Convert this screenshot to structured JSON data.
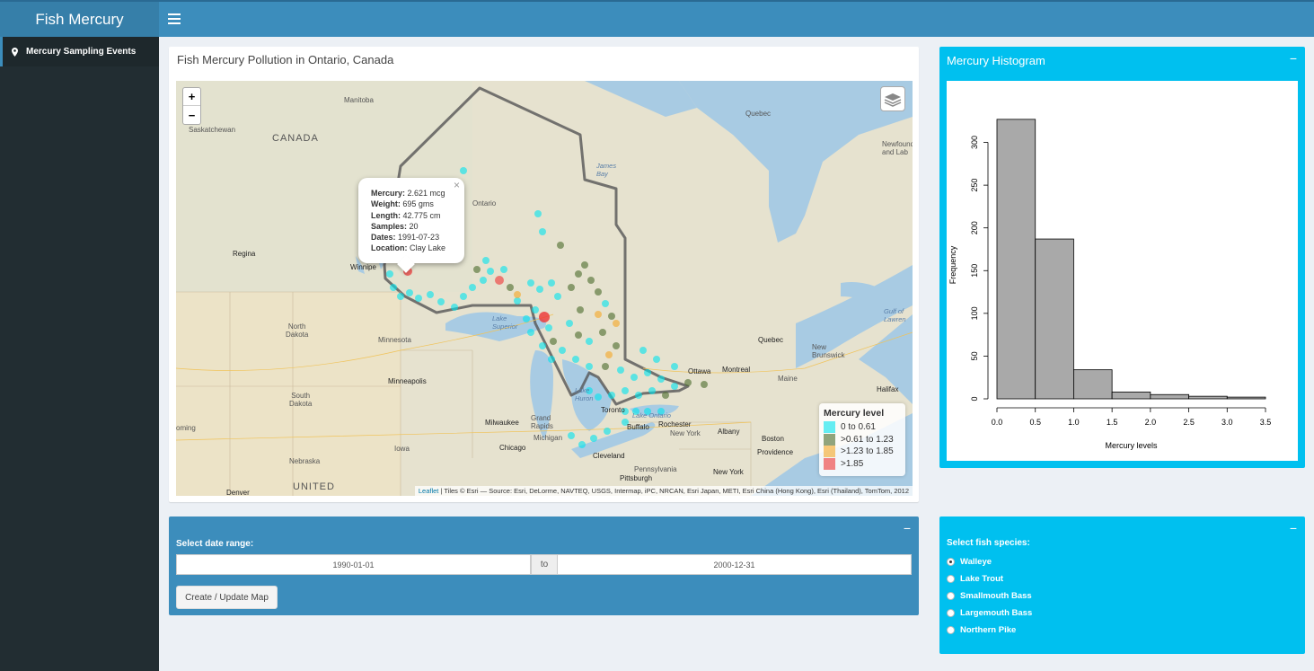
{
  "app": {
    "title": "Fish Mercury"
  },
  "sidebar": {
    "items": [
      {
        "label": "Mercury Sampling Events",
        "icon": "map-marker-icon"
      }
    ]
  },
  "map_box": {
    "title": "Fish Mercury Pollution in Ontario, Canada",
    "zoom_in": "+",
    "zoom_out": "−",
    "popup": {
      "close": "×",
      "rows": [
        {
          "key": "Mercury:",
          "value": "2.621 mcg"
        },
        {
          "key": "Weight:",
          "value": "695 gms"
        },
        {
          "key": "Length:",
          "value": "42.775 cm"
        },
        {
          "key": "Samples:",
          "value": "20"
        },
        {
          "key": "Dates:",
          "value": "1991-07-23"
        },
        {
          "key": "Location:",
          "value": "Clay Lake"
        }
      ]
    },
    "legend": {
      "title": "Mercury level",
      "items": [
        {
          "label": "0 to 0.61",
          "color": "#00e5ee"
        },
        {
          "label": ">0.61 to 1.23",
          "color": "#4a6b2a"
        },
        {
          "label": ">1.23 to 1.85",
          "color": "#f5a623"
        },
        {
          "label": ">1.85",
          "color": "#ee3333"
        }
      ]
    },
    "attribution": {
      "link": "Leaflet",
      "text": " | Tiles © Esri — Source: Esri, DeLorme, NAVTEQ, USGS, Intermap, iPC, NRCAN, Esri Japan, METI, Esri China (Hong Kong), Esri (Thailand), TomTom, 2012"
    },
    "labels": {
      "canada": "CANADA",
      "united": "UNITED",
      "manitoba": "Manitoba",
      "saskatchewan": "Saskatchewan",
      "quebec_prov": "Quebec",
      "ontario": "Ontario",
      "james_bay": "James\nBay",
      "newfoundland": "Newfound\nand Lab",
      "regina": "Regina",
      "winnipeg": "Winnipe",
      "north_dakota": "North\nDakota",
      "south_dakota": "South\nDakota",
      "minnesota": "Minnesota",
      "minneapolis": "Minneapolis",
      "nebraska": "Nebraska",
      "iowa": "Iowa",
      "wyoming": "oming",
      "denver": "Denver",
      "lake_superior": "Lake\nSuperior",
      "lake_michigan": "Lake\nMichigan",
      "lake_huron": "Lake\nHuron",
      "lake_ontario": "Lake Ontario",
      "milwaukee": "Milwaukee",
      "grand_rapids": "Grand\nRapids",
      "michigan": "Michigan",
      "chicago": "Chicago",
      "toronto": "Toronto",
      "buffalo": "Buffalo",
      "rochester": "Rochester",
      "cleveland": "Cleveland",
      "pittsburgh": "Pittsburgh",
      "pennsylvania": "Pennsylvania",
      "new_york": "New York",
      "new_york_city": "New York",
      "ottawa": "Ottawa",
      "montreal": "Montreal",
      "quebec_city": "Quebec",
      "albany": "Albany",
      "boston": "Boston",
      "providence": "Providence",
      "maine": "Maine",
      "new_brunswick": "New\nBrunswick",
      "halifax": "Halifax",
      "gulf": "Gulf of\nLawren"
    }
  },
  "histogram": {
    "title": "Mercury Histogram",
    "collapse": "−",
    "chart_data": {
      "type": "bar",
      "xlabel": "Mercury levels",
      "ylabel": "Frequency",
      "bins": [
        [
          0.0,
          0.5
        ],
        [
          0.5,
          1.0
        ],
        [
          1.0,
          1.5
        ],
        [
          1.5,
          2.0
        ],
        [
          2.0,
          2.5
        ],
        [
          2.5,
          3.0
        ],
        [
          3.0,
          3.5
        ]
      ],
      "values": [
        327,
        187,
        34,
        8,
        5,
        3,
        2
      ],
      "xlim": [
        0,
        3.5
      ],
      "ylim": [
        0,
        330
      ],
      "xticks": [
        "0.0",
        "0.5",
        "1.0",
        "1.5",
        "2.0",
        "2.5",
        "3.0",
        "3.5"
      ],
      "yticks": [
        "0",
        "50",
        "100",
        "150",
        "200",
        "250",
        "300"
      ],
      "bar_color": "#a9a9a9",
      "grid": false
    }
  },
  "date_box": {
    "label": "Select date range:",
    "start": "1990-01-01",
    "separator": "to",
    "end": "2000-12-31",
    "button": "Create / Update Map",
    "collapse": "−"
  },
  "species_box": {
    "label": "Select fish species:",
    "collapse": "−",
    "options": [
      {
        "label": "Walleye",
        "selected": true
      },
      {
        "label": "Lake Trout",
        "selected": false
      },
      {
        "label": "Smallmouth Bass",
        "selected": false
      },
      {
        "label": "Largemouth Bass",
        "selected": false
      },
      {
        "label": "Northern Pike",
        "selected": false
      }
    ]
  }
}
